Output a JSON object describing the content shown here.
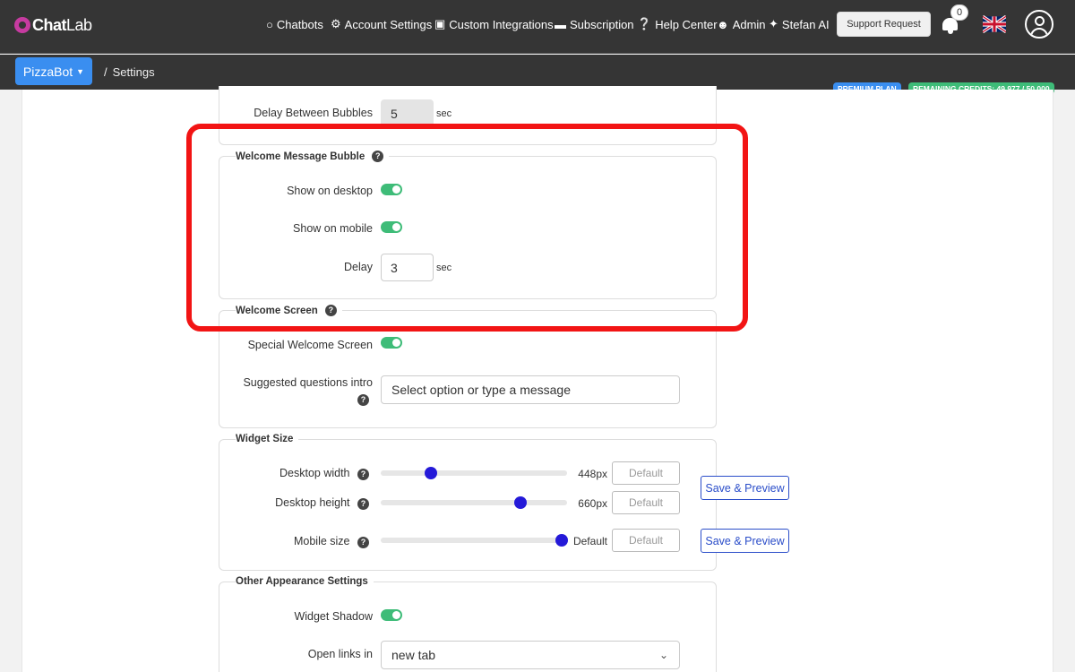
{
  "brand": {
    "name_bold": "Chat",
    "name_light": "Lab"
  },
  "nav": [
    {
      "icon": "robot-icon",
      "label": "Chatbots"
    },
    {
      "icon": "gear-icon",
      "label": "Account Settings"
    },
    {
      "icon": "puzzle-icon",
      "label": "Custom Integrations"
    },
    {
      "icon": "credit-card-icon",
      "label": "Subscription"
    },
    {
      "icon": "question-circle-icon",
      "label": "Help Center"
    },
    {
      "icon": "user-gear-icon",
      "label": "Admin"
    },
    {
      "icon": "magic-wand-icon",
      "label": "Stefan AI"
    }
  ],
  "support_button": "Support Request",
  "notifications_count": "0",
  "bot_selector": "PizzaBot",
  "breadcrumb": {
    "separator": "/",
    "current": "Settings"
  },
  "badges": {
    "plan": "PREMIUM PLAN",
    "credits": "REMAINING CREDITS: 49,977 / 50,000"
  },
  "delay_between_bubbles": {
    "label": "Delay Between Bubbles",
    "value": "5",
    "unit": "sec"
  },
  "welcome_bubble": {
    "title": "Welcome Message Bubble",
    "help": "?",
    "show_desktop": {
      "label": "Show on desktop",
      "enabled": true
    },
    "show_mobile": {
      "label": "Show on mobile",
      "enabled": true
    },
    "delay": {
      "label": "Delay",
      "value": "3",
      "unit": "sec"
    }
  },
  "welcome_screen": {
    "title": "Welcome Screen",
    "help": "?",
    "special": {
      "label": "Special Welcome Screen",
      "enabled": true
    },
    "suggested": {
      "label": "Suggested questions intro",
      "help": "?",
      "placeholder": "Select option or type a message"
    }
  },
  "widget_size": {
    "title": "Widget Size",
    "desktop_width": {
      "label": "Desktop width",
      "help": "?",
      "value": "448px",
      "level": 0.27,
      "default_label": "Default"
    },
    "desktop_height": {
      "label": "Desktop height",
      "help": "?",
      "value": "660px",
      "level": 0.75,
      "default_label": "Default"
    },
    "mobile_size": {
      "label": "Mobile size",
      "help": "?",
      "value": "Default",
      "level": 0.97,
      "default_label": "Default"
    },
    "save_preview": "Save & Preview"
  },
  "other": {
    "title": "Other Appearance Settings",
    "widget_shadow": {
      "label": "Widget Shadow",
      "enabled": true
    },
    "open_links": {
      "label": "Open links in",
      "value": "new tab"
    }
  },
  "colors": {
    "accent": "#3a8ef0",
    "toggle_on": "#3ebc78",
    "slider_knob": "#2419d8",
    "highlight": "#f21414",
    "topbar": "#353535"
  }
}
